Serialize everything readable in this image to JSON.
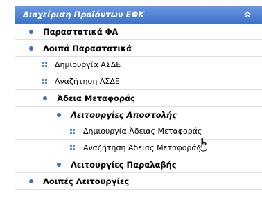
{
  "panel": {
    "title": "Διαχείριση Προϊόντων ΕΦΚ"
  },
  "menu": {
    "items": [
      {
        "label": "Παραστατικά ΦΑ"
      },
      {
        "label": "Λοιπά Παραστατικά"
      },
      {
        "label": "Δημιουργία ΑΣΔΕ"
      },
      {
        "label": "Αναζήτηση ΑΣΔΕ"
      },
      {
        "label": "Άδεια Μεταφοράς"
      },
      {
        "label": "Λειτουργίες Αποστολής"
      },
      {
        "label": "Δημιουργία Άδειας Μεταφοράς"
      },
      {
        "label": "Αναζήτηση Άδειας Μεταφοράς"
      },
      {
        "label": "Λειτουργίες Παραλαβής"
      },
      {
        "label": "Λοιπές Λειτουργίες"
      }
    ]
  },
  "colors": {
    "header_top": "#6b99e0",
    "header_bottom": "#3f73c9",
    "bullet": "#3a6fd0",
    "square": "#4a8be0",
    "divider": "#d9e3f0"
  },
  "icons": {
    "collapse": "double-chevron-up-icon",
    "cursor": "hand-pointer-icon"
  }
}
